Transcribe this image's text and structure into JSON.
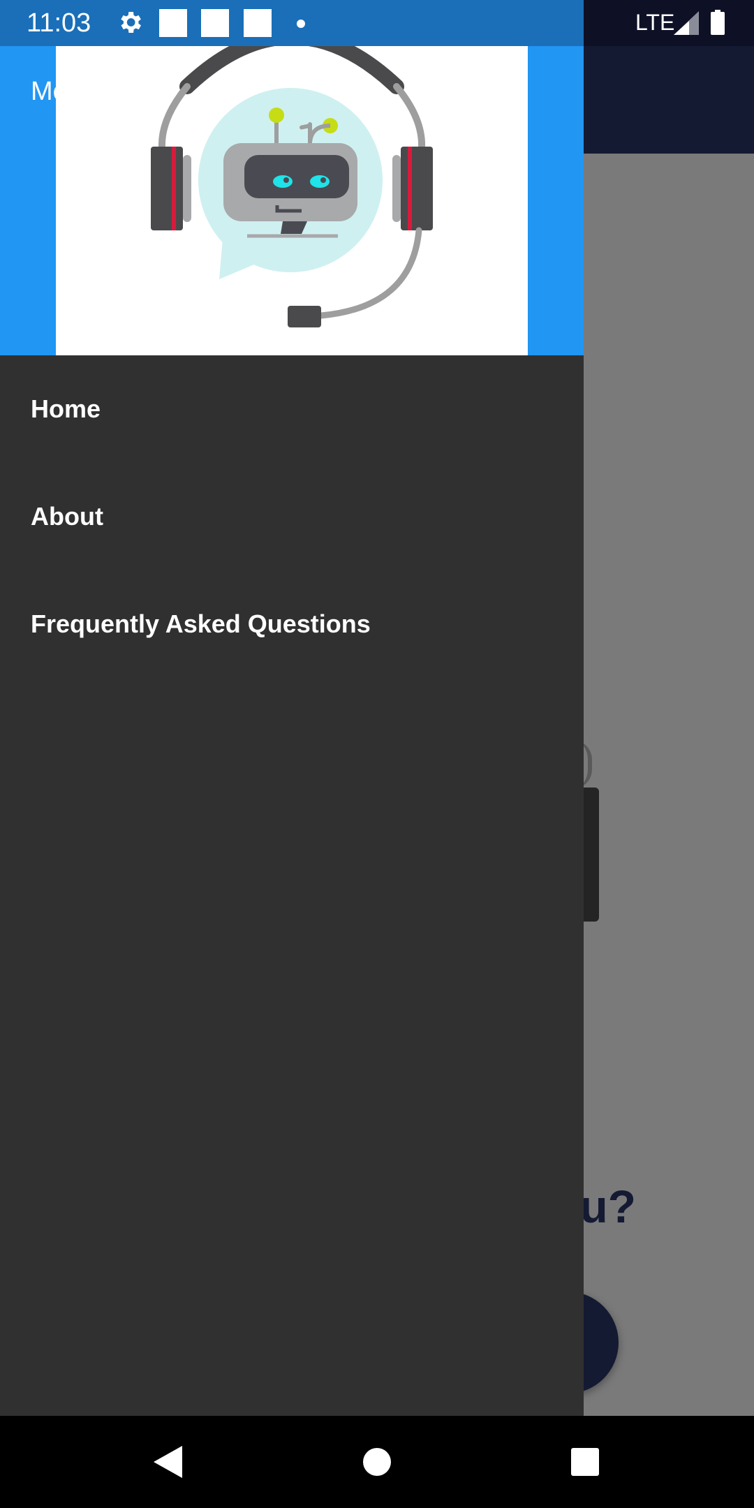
{
  "status_bar": {
    "time": "11:03",
    "network": "LTE",
    "icons": [
      "gear-icon",
      "notification-icon",
      "notification-icon",
      "notification-icon",
      "dot-icon",
      "signal-icon",
      "battery-icon"
    ]
  },
  "background": {
    "question_text": "ou?",
    "colors": {
      "app_bar": "#151a33",
      "scrim": "#7a7a7a"
    }
  },
  "drawer": {
    "header_title": "Me",
    "header_color": "#2196f3",
    "illustration": "support-robot-headset",
    "items": [
      {
        "label": "Home"
      },
      {
        "label": "About"
      },
      {
        "label": "Frequently Asked Questions"
      }
    ]
  },
  "nav_bar": {
    "icons": [
      "back-icon",
      "home-icon",
      "recents-icon"
    ]
  }
}
